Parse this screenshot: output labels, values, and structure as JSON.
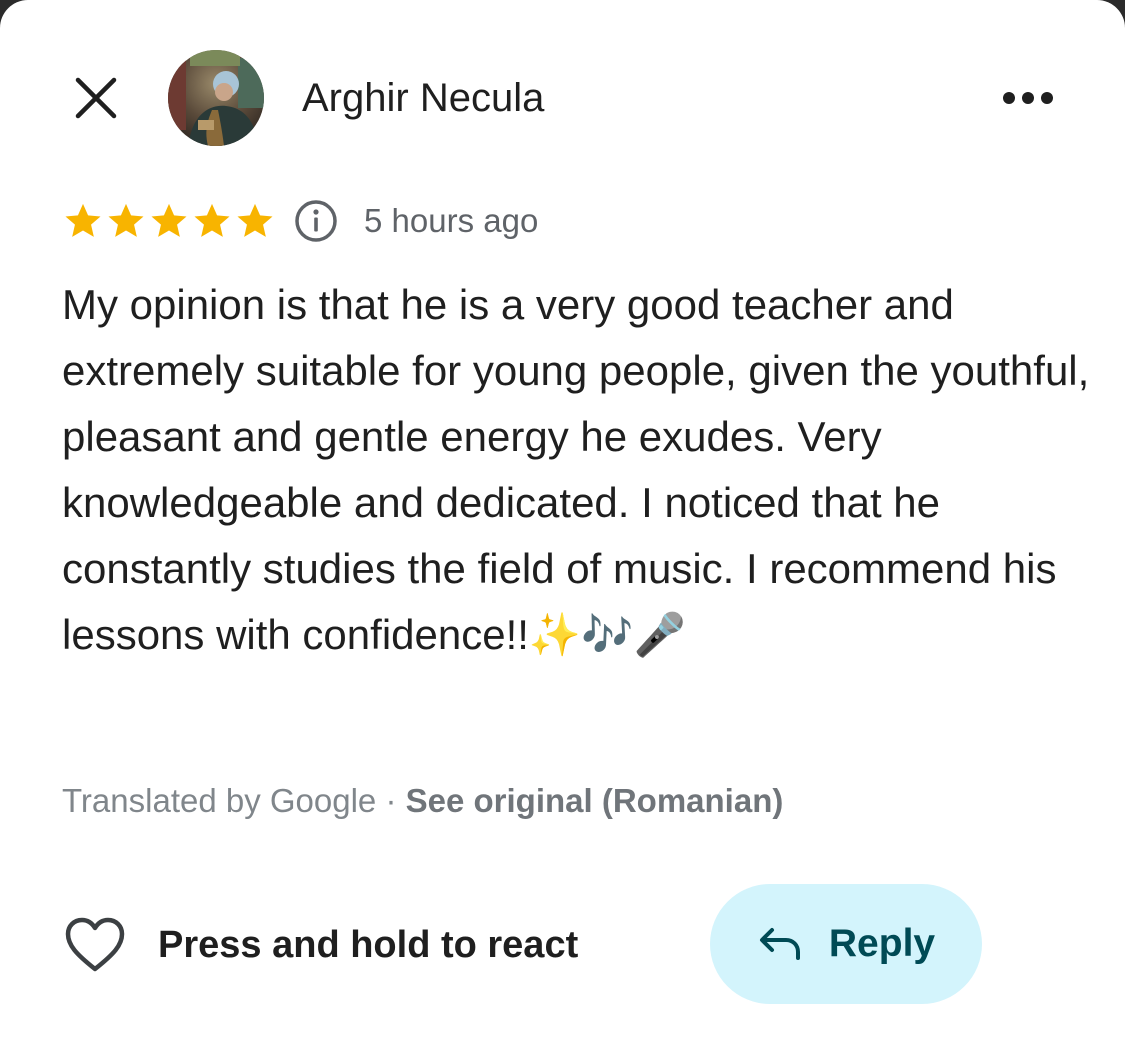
{
  "header": {
    "close_icon": "close-icon",
    "author_name": "Arghir Necula",
    "more_icon": "more-horizontal-icon"
  },
  "review": {
    "rating": 5,
    "rating_max": 5,
    "star_color": "#f8b400",
    "info_icon": "info-icon",
    "time_ago": "5 hours ago",
    "text": "My opinion is that he is a very good teacher and extremely suitable for young people, given the youthful, pleasant and gentle energy he exudes. Very knowledgeable and dedicated. I noticed that he constantly studies the field of music. I recommend his lessons with confidence!!",
    "emojis": "✨🎶🎤"
  },
  "translation": {
    "label": "Translated by Google",
    "separator": " · ",
    "see_original": "See original (Romanian)"
  },
  "actions": {
    "react_label": "Press and hold to react",
    "reply_label": "Reply",
    "reply_bg": "#d3f4fc",
    "reply_text_color": "#004a55"
  }
}
